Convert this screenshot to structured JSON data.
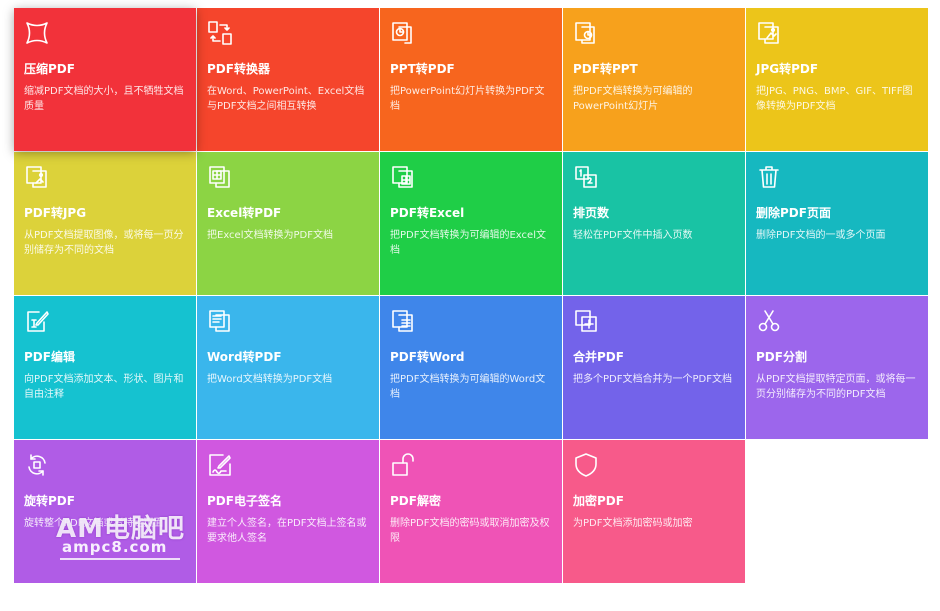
{
  "tiles": [
    {
      "title": "压缩PDF",
      "desc": "缩减PDF文档的大小，且不牺牲文档质量",
      "color": "#f2323a",
      "icon": "compress-icon"
    },
    {
      "title": "PDF转换器",
      "desc": "在Word、PowerPoint、Excel文档与PDF文档之间相互转换",
      "color": "#f5452c",
      "icon": "convert-icon"
    },
    {
      "title": "PPT转PDF",
      "desc": "把PowerPoint幻灯片转换为PDF文档",
      "color": "#f7651e",
      "icon": "ppt-icon"
    },
    {
      "title": "PDF转PPT",
      "desc": "把PDF文档转换为可编辑的PowerPoint幻灯片",
      "color": "#f7a11c",
      "icon": "ppt-file-icon"
    },
    {
      "title": "JPG转PDF",
      "desc": "把JPG、PNG、BMP、GIF、TIFF图像转换为PDF文档",
      "color": "#ecc51a",
      "icon": "image-icon"
    },
    {
      "title": "PDF转JPG",
      "desc": "从PDF文档提取图像，或将每一页分别储存为不同的文档",
      "color": "#dcd23a",
      "icon": "jpg-file-icon"
    },
    {
      "title": "Excel转PDF",
      "desc": "把Excel文档转换为PDF文档",
      "color": "#8cd444",
      "icon": "table-icon"
    },
    {
      "title": "PDF转Excel",
      "desc": "把PDF文档转换为可编辑的Excel文档",
      "color": "#1fce47",
      "icon": "excel-file-icon"
    },
    {
      "title": "排页数",
      "desc": "轻松在PDF文件中插入页数",
      "color": "#19c3a4",
      "icon": "page-number-icon"
    },
    {
      "title": "删除PDF页面",
      "desc": "删除PDF文档的一或多个页面",
      "color": "#16b8c0",
      "icon": "trash-icon"
    },
    {
      "title": "PDF编辑",
      "desc": "向PDF文档添加文本、形状、图片和自由注释",
      "color": "#15c2d0",
      "icon": "edit-icon"
    },
    {
      "title": "Word转PDF",
      "desc": "把Word文档转换为PDF文档",
      "color": "#3ab6ec",
      "icon": "document-icon"
    },
    {
      "title": "PDF转Word",
      "desc": "把PDF文档转换为可编辑的Word文档",
      "color": "#3f86ea",
      "icon": "word-file-icon"
    },
    {
      "title": "合并PDF",
      "desc": "把多个PDF文档合并为一个PDF文档",
      "color": "#7363ea",
      "icon": "merge-icon"
    },
    {
      "title": "PDF分割",
      "desc": "从PDF文档提取特定页面，或将每一页分别储存为不同的PDF文档",
      "color": "#9c66ec",
      "icon": "scissors-icon"
    },
    {
      "title": "旋转PDF",
      "desc": "旋转整个PDF文档或者特定页面",
      "color": "#b05ce6",
      "icon": "rotate-icon"
    },
    {
      "title": "PDF电子签名",
      "desc": "建立个人签名，在PDF文档上签名或要求他人签名",
      "color": "#d058e0",
      "icon": "signature-icon"
    },
    {
      "title": "PDF解密",
      "desc": "删除PDF文档的密码或取消加密及权限",
      "color": "#ef53b6",
      "icon": "unlock-icon"
    },
    {
      "title": "加密PDF",
      "desc": "为PDF文档添加密码或加密",
      "color": "#f75a8a",
      "icon": "shield-icon"
    }
  ],
  "watermark": {
    "big": "AM电脑吧",
    "small": "ampc8.com"
  }
}
